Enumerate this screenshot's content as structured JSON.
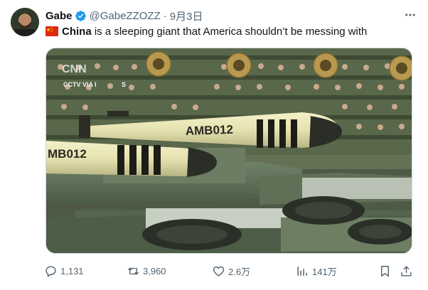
{
  "tweet": {
    "author_name": "Gabe",
    "handle": "@GabeZZOZZ",
    "separator": "·",
    "date": "9月3日",
    "flag_icon": "china-flag-icon",
    "text_bold": "China",
    "text_rest": " is a sleeping giant that America shouldn’t be messing with",
    "media": {
      "watermark": "CNN",
      "caption": "CCTV VIA I",
      "caption_tail": "S",
      "missile_labels": [
        "AMB012",
        "MB012"
      ]
    }
  },
  "actions": {
    "reply_count": "1,131",
    "retweet_count": "3,960",
    "like_count": "2.6万",
    "views_count": "141万"
  },
  "colors": {
    "verified": "#1d9bf0",
    "secondary_text": "#536471"
  }
}
